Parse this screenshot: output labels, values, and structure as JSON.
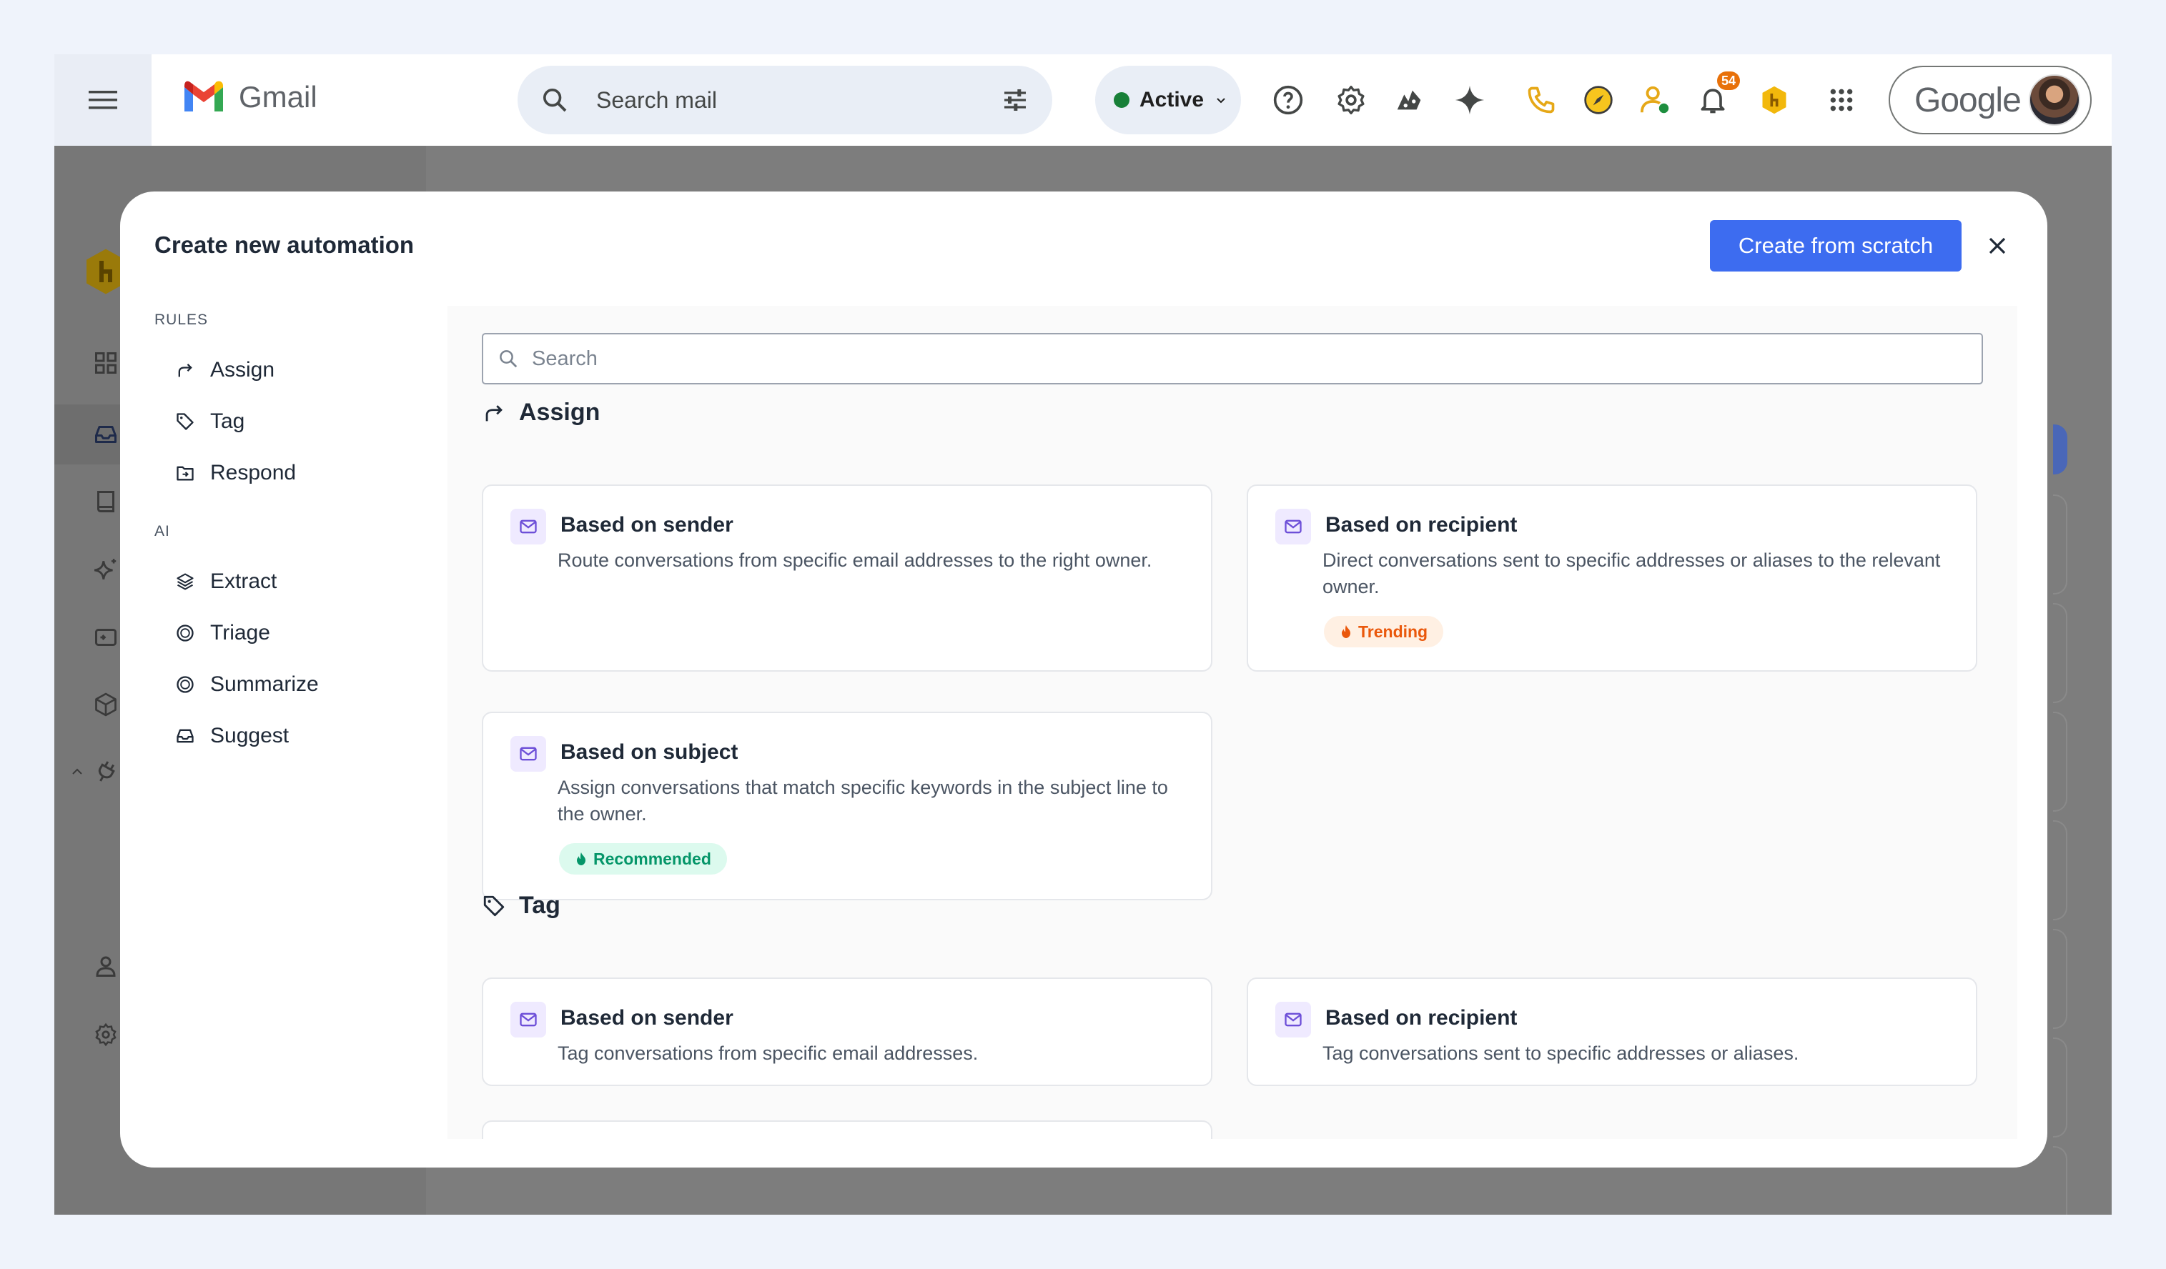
{
  "gmail": {
    "app_name": "Gmail",
    "search_placeholder": "Search mail",
    "status_label": "Active",
    "notification_count": "54",
    "account_label": "Google",
    "colors": {
      "status_dot": "#188038",
      "badge": "#e8710a"
    }
  },
  "modal": {
    "title": "Create new automation",
    "create_button": "Create from scratch",
    "search_placeholder": "Search",
    "nav": {
      "rules_heading": "RULES",
      "rules": [
        {
          "label": "Assign",
          "icon": "assign-arrow-icon"
        },
        {
          "label": "Tag",
          "icon": "tag-icon"
        },
        {
          "label": "Respond",
          "icon": "respond-icon"
        }
      ],
      "ai_heading": "AI",
      "ai": [
        {
          "label": "Extract",
          "icon": "layers-icon"
        },
        {
          "label": "Triage",
          "icon": "circle-icon"
        },
        {
          "label": "Summarize",
          "icon": "circle-icon"
        },
        {
          "label": "Suggest",
          "icon": "inbox-icon"
        }
      ]
    },
    "sections": [
      {
        "title": "Assign",
        "cards": [
          {
            "title": "Based on sender",
            "description": "Route conversations from specific email addresses to the right owner.",
            "badge": ""
          },
          {
            "title": "Based on recipient",
            "description": "Direct conversations sent to specific addresses or aliases to the relevant owner.",
            "badge": "Trending"
          },
          {
            "title": "Based on subject",
            "description": "Assign conversations that match specific keywords in the subject line to the owner.",
            "badge": "Recommended"
          }
        ]
      },
      {
        "title": "Tag",
        "cards": [
          {
            "title": "Based on sender",
            "description": "Tag conversations from specific email addresses.",
            "badge": ""
          },
          {
            "title": "Based on recipient",
            "description": "Tag conversations sent to specific addresses or aliases.",
            "badge": ""
          }
        ]
      }
    ],
    "colors": {
      "primary": "#3d6cf0",
      "trending": "#ea580c",
      "recommended": "#059669"
    }
  }
}
